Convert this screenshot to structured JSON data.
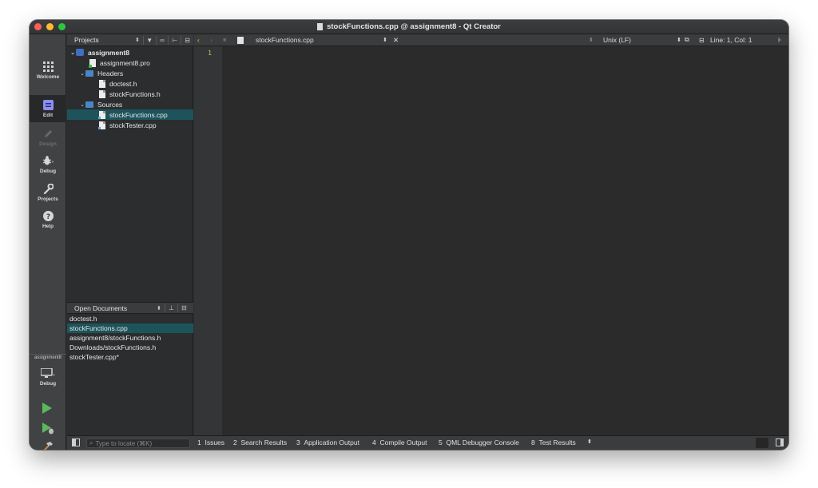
{
  "window": {
    "title": "stockFunctions.cpp @ assignment8 - Qt Creator"
  },
  "modes": [
    {
      "label": "Welcome",
      "icon": "grid-icon"
    },
    {
      "label": "Edit",
      "icon": "edit-icon"
    },
    {
      "label": "Design",
      "icon": "pencil-icon"
    },
    {
      "label": "Debug",
      "icon": "bug-icon"
    },
    {
      "label": "Projects",
      "icon": "wrench-icon"
    },
    {
      "label": "Help",
      "icon": "help-icon"
    }
  ],
  "kit": {
    "project": "assignment8",
    "mode": "Debug"
  },
  "projects_pane": {
    "title": "Projects",
    "tree": [
      {
        "label": "assignment8",
        "kind": "project",
        "level": 0,
        "expanded": true
      },
      {
        "label": "assignment8.pro",
        "kind": "pro",
        "level": 1
      },
      {
        "label": "Headers",
        "kind": "folder",
        "level": 1,
        "expanded": true
      },
      {
        "label": "doctest.h",
        "kind": "file",
        "level": 2
      },
      {
        "label": "stockFunctions.h",
        "kind": "file",
        "level": 2
      },
      {
        "label": "Sources",
        "kind": "folder",
        "level": 1,
        "expanded": true
      },
      {
        "label": "stockFunctions.cpp",
        "kind": "cpp",
        "level": 2,
        "selected": true
      },
      {
        "label": "stockTester.cpp",
        "kind": "cpp",
        "level": 2
      }
    ]
  },
  "open_documents": {
    "title": "Open Documents",
    "items": [
      {
        "label": "doctest.h"
      },
      {
        "label": "stockFunctions.cpp",
        "selected": true
      },
      {
        "label": "assignment8/stockFunctions.h"
      },
      {
        "label": "Downloads/stockFunctions.h"
      },
      {
        "label": "stockTester.cpp*"
      }
    ]
  },
  "editor": {
    "file": "stockFunctions.cpp",
    "line_ending": "Unix (LF)",
    "cursor": "Line: 1, Col: 1",
    "line_numbers": [
      "1"
    ]
  },
  "locator": {
    "placeholder": "Type to locate (⌘K)"
  },
  "output_tabs": [
    {
      "num": "1",
      "label": "Issues"
    },
    {
      "num": "2",
      "label": "Search Results"
    },
    {
      "num": "3",
      "label": "Application Output"
    },
    {
      "num": "4",
      "label": "Compile Output"
    },
    {
      "num": "5",
      "label": "QML Debugger Console"
    },
    {
      "num": "8",
      "label": "Test Results"
    }
  ],
  "colors": {
    "selection": "#1d545c",
    "line_number": "#d7c04a",
    "run": "#5cb85c"
  }
}
